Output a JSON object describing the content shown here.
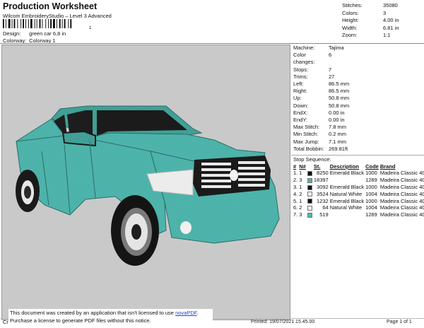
{
  "header": {
    "title": "Production Worksheet",
    "software": "Wilcom EmbroideryStudio – Level 3 Advanced",
    "barcode_caption": "1",
    "design_label": "Design:",
    "design_value": "green car 6,8 in",
    "colorway_label": "Colorway:",
    "colorway_value": "Colorway 1"
  },
  "stats": [
    {
      "label": "Stitches:",
      "value": "35080"
    },
    {
      "label": "Colors:",
      "value": "3"
    },
    {
      "label": "Height:",
      "value": "4.00 in"
    },
    {
      "label": "Width:",
      "value": "6.81 in"
    },
    {
      "label": "Zoom:",
      "value": "1:1"
    }
  ],
  "params": [
    {
      "label": "Machine:",
      "value": "Tajima"
    },
    {
      "label": "Color changes:",
      "value": "6"
    },
    {
      "label": "Stops:",
      "value": "7"
    },
    {
      "label": "Trims:",
      "value": "27"
    },
    {
      "label": "Left:",
      "value": "86.5 mm"
    },
    {
      "label": "Right:",
      "value": "86.5 mm"
    },
    {
      "label": "Up:",
      "value": "50.8 mm"
    },
    {
      "label": "Down:",
      "value": "50.8 mm"
    },
    {
      "label": "EndX:",
      "value": "0.00 in"
    },
    {
      "label": "EndY:",
      "value": "0.00 in"
    },
    {
      "label": "Max Stitch:",
      "value": "7.8 mm"
    },
    {
      "label": "Min Stitch:",
      "value": "0.2 mm"
    },
    {
      "label": "Max Jump:",
      "value": "7.1 mm"
    },
    {
      "label": "Total Bobbin:",
      "value": "269.81ft"
    }
  ],
  "sequence": {
    "title": "Stop Sequence:",
    "headers": [
      "#",
      "N#",
      "",
      "St.",
      "Description",
      "Code",
      "Brand"
    ],
    "rows": [
      {
        "idx": "1.",
        "n": "1",
        "color": "#111111",
        "st": "8250",
        "desc": "Emerald Black",
        "code": "1000",
        "brand": "Madeira Classic 40"
      },
      {
        "idx": "2.",
        "n": "3",
        "color": "#4fb6ad",
        "st": "18397",
        "desc": "",
        "code": "1289",
        "brand": "Madeira Classic 40"
      },
      {
        "idx": "3.",
        "n": "1",
        "color": "#111111",
        "st": "3092",
        "desc": "Emerald Black",
        "code": "1000",
        "brand": "Madeira Classic 40"
      },
      {
        "idx": "4.",
        "n": "2",
        "color": "#f0f0f0",
        "st": "3524",
        "desc": "Natural White",
        "code": "1004",
        "brand": "Madeira Classic 40"
      },
      {
        "idx": "5.",
        "n": "1",
        "color": "#111111",
        "st": "1232",
        "desc": "Emerald Black",
        "code": "1000",
        "brand": "Madeira Classic 40"
      },
      {
        "idx": "6.",
        "n": "2",
        "color": "#f0f0f0",
        "st": "64",
        "desc": "Natural White",
        "code": "1004",
        "brand": "Madeira Classic 40"
      },
      {
        "idx": "7.",
        "n": "3",
        "color": "#4fb6ad",
        "st": "519",
        "desc": "",
        "code": "1289",
        "brand": "Madeira Classic 40"
      }
    ]
  },
  "notice": {
    "line1_prefix": "This document was created by an application that isn't licensed to use ",
    "link": "novaPDF",
    "line1_suffix": ".",
    "line2": "Purchase a license to generate PDF files without this notice."
  },
  "footer": {
    "cr": "Cr",
    "printed": "Printed: 19/07/2021 15.45.00",
    "page": "Page 1 of 1"
  }
}
